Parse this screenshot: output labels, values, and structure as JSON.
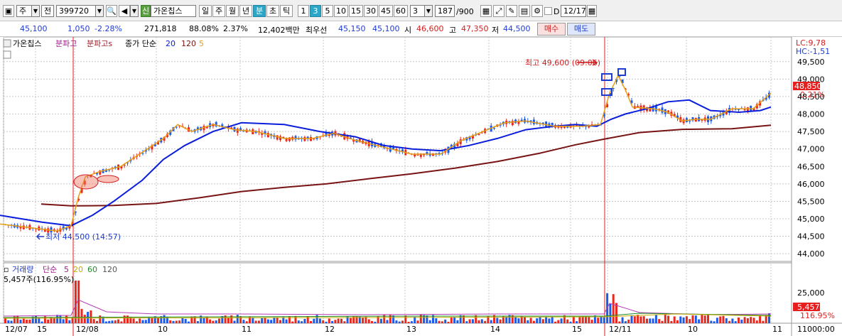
{
  "toolbar": {
    "type_label": "주",
    "type2_label": "전",
    "code": "399720",
    "stock_name": "가온칩스",
    "badge": "신",
    "periods": [
      "일",
      "주",
      "월",
      "년",
      "분",
      "초",
      "틱"
    ],
    "selected_period": "분",
    "intervals": [
      "1",
      "3",
      "5",
      "10",
      "15",
      "30",
      "45",
      "60"
    ],
    "selected_interval": "3",
    "interval_value": "3",
    "count": "187",
    "count_total": "/900",
    "date": "12/17",
    "date_prefix": "D"
  },
  "quote": {
    "price": "45,100",
    "change": "1,050",
    "rate": "-2.28%",
    "volume": "271,818",
    "vol_ratio": "88.08%",
    "turnover": "2.37%",
    "amount": "12,402백만",
    "best_bid_label": "최우선",
    "best_ask": "45,150",
    "best_bid": "45,100",
    "open_label": "시",
    "open": "46,600",
    "high_label": "고",
    "high": "47,350",
    "low_label": "저",
    "low": "44,500",
    "buy_label": "매수",
    "sell_label": "매도"
  },
  "legend_price": {
    "name": "가온칩스",
    "item1": "분파고",
    "item2": "분파고s",
    "item3": "종가 단순",
    "ma1": "20",
    "ma2": "120",
    "ma3": "5"
  },
  "legend_volume": {
    "name": "거래량",
    "method": "단순",
    "ma1": "5",
    "ma2": "20",
    "ma3": "60",
    "ma4": "120",
    "current": "5,457주(116.95%)"
  },
  "annotations": {
    "high": "최고 49,600 (09:06)",
    "low": "최저 44,500 (14:57)",
    "lc": "LC:9,78",
    "hc": "HC:-1,51",
    "price_tag": "48,850",
    "pct_tag": "0.21%",
    "vol_tag": "5,457",
    "vol_pct_tag": "116.95%"
  },
  "colors": {
    "up": "#e8281e",
    "down": "#1e5ae6",
    "ma5": "#e6a015",
    "ma20": "#0a1edc",
    "ma120": "#781414"
  },
  "chart_data": {
    "type": "candlestick",
    "y_ticks": [
      "49,500",
      "49,000",
      "48,500",
      "48,000",
      "47,500",
      "47,000",
      "46,500",
      "46,000",
      "45,500",
      "45,000",
      "44,500",
      "44,000"
    ],
    "vol_ticks": [
      "25,000",
      "11000:00"
    ],
    "x_ticks": [
      "12/07",
      "15",
      "12/08",
      "10",
      "11",
      "12",
      "13",
      "14",
      "15",
      "12/11",
      "10",
      "11"
    ],
    "ylim": [
      43800,
      49800
    ],
    "ma20": [
      [
        0,
        45100
      ],
      [
        30,
        45000
      ],
      [
        60,
        44900
      ],
      [
        100,
        44800
      ],
      [
        130,
        45100
      ],
      [
        160,
        45500
      ],
      [
        200,
        46100
      ],
      [
        230,
        46700
      ],
      [
        260,
        47100
      ],
      [
        300,
        47500
      ],
      [
        340,
        47750
      ],
      [
        400,
        47700
      ],
      [
        450,
        47500
      ],
      [
        500,
        47350
      ],
      [
        540,
        47100
      ],
      [
        580,
        47000
      ],
      [
        620,
        46950
      ],
      [
        660,
        47100
      ],
      [
        700,
        47300
      ],
      [
        740,
        47550
      ],
      [
        780,
        47650
      ],
      [
        810,
        47700
      ],
      [
        840,
        47650
      ],
      [
        860,
        47850
      ],
      [
        880,
        48000
      ],
      [
        910,
        48150
      ],
      [
        940,
        48350
      ],
      [
        970,
        48400
      ],
      [
        1000,
        48100
      ],
      [
        1040,
        48050
      ],
      [
        1070,
        48100
      ],
      [
        1085,
        48200
      ]
    ],
    "ma120": [
      [
        58,
        45420
      ],
      [
        100,
        45370
      ],
      [
        160,
        45380
      ],
      [
        220,
        45440
      ],
      [
        280,
        45600
      ],
      [
        340,
        45780
      ],
      [
        400,
        45900
      ],
      [
        460,
        46000
      ],
      [
        520,
        46150
      ],
      [
        580,
        46290
      ],
      [
        640,
        46450
      ],
      [
        700,
        46640
      ],
      [
        760,
        46880
      ],
      [
        810,
        47120
      ],
      [
        850,
        47280
      ],
      [
        900,
        47470
      ],
      [
        960,
        47560
      ],
      [
        1030,
        47580
      ],
      [
        1085,
        47680
      ]
    ],
    "ma5": [
      [
        0,
        44850
      ],
      [
        40,
        44750
      ],
      [
        80,
        44650
      ],
      [
        100,
        44800
      ],
      [
        110,
        45600
      ],
      [
        120,
        46200
      ],
      [
        140,
        46350
      ],
      [
        170,
        46500
      ],
      [
        200,
        46900
      ],
      [
        230,
        47300
      ],
      [
        250,
        47700
      ],
      [
        270,
        47500
      ],
      [
        300,
        47700
      ],
      [
        330,
        47550
      ],
      [
        360,
        47500
      ],
      [
        400,
        47300
      ],
      [
        440,
        47300
      ],
      [
        470,
        47450
      ],
      [
        500,
        47250
      ],
      [
        540,
        47050
      ],
      [
        580,
        46850
      ],
      [
        620,
        46850
      ],
      [
        650,
        47250
      ],
      [
        680,
        47500
      ],
      [
        710,
        47750
      ],
      [
        740,
        47800
      ],
      [
        780,
        47650
      ],
      [
        820,
        47650
      ],
      [
        845,
        47700
      ],
      [
        858,
        48600
      ],
      [
        870,
        49100
      ],
      [
        880,
        48700
      ],
      [
        890,
        48200
      ],
      [
        920,
        48150
      ],
      [
        940,
        48050
      ],
      [
        960,
        47800
      ],
      [
        980,
        47850
      ],
      [
        1000,
        47850
      ],
      [
        1030,
        48150
      ],
      [
        1060,
        48150
      ],
      [
        1085,
        48600
      ]
    ],
    "high_label_price": 49600,
    "low_label_price": 44500,
    "last_price": 48850
  }
}
